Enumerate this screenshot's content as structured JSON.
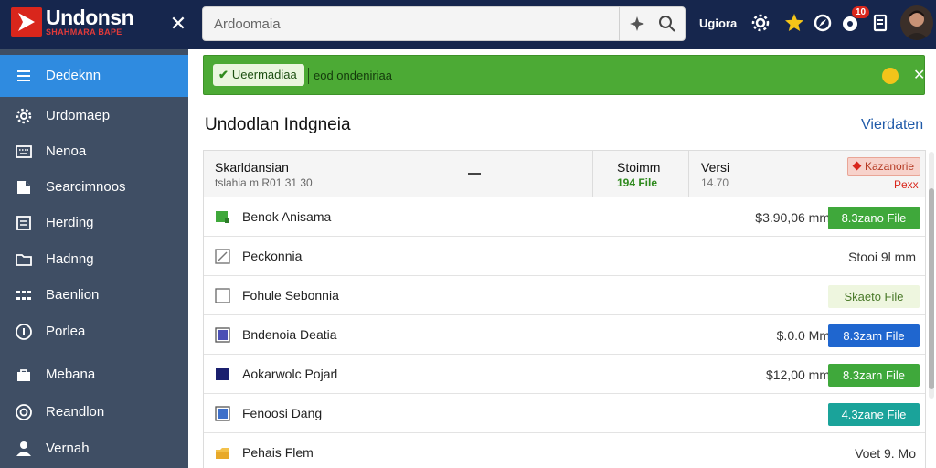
{
  "header": {
    "logo_text": "Undonsn",
    "logo_sub": "SHAHMARA BAPE",
    "search_placeholder": "Ardoomaia",
    "label": "Ugiora",
    "badge": "10",
    "icons": [
      "brand-logo-icon",
      "close-icon",
      "sparkle-icon",
      "search-icon",
      "settings-icon",
      "star-icon",
      "compass-icon",
      "shield-icon",
      "bookmark-icon",
      "avatar"
    ]
  },
  "sidebar": {
    "items": [
      {
        "label": "Dedeknn",
        "icon": "menu-icon",
        "active": true
      },
      {
        "label": "Urdomaep",
        "icon": "gear-icon"
      },
      {
        "label": "Nenoa",
        "icon": "keyboard-icon"
      },
      {
        "label": "Searcimnoos",
        "icon": "file-icon"
      },
      {
        "label": "Herding",
        "icon": "list-icon"
      },
      {
        "label": "Hadnng",
        "icon": "folder-icon"
      },
      {
        "label": "Baenlion",
        "icon": "grid-icon"
      },
      {
        "label": "Porlea",
        "icon": "info-icon"
      },
      {
        "label": "Mebana",
        "icon": "bag-icon"
      },
      {
        "label": "Reandlon",
        "icon": "circle-icon"
      },
      {
        "label": "Vernah",
        "icon": "person-icon"
      }
    ]
  },
  "banner": {
    "pill": "Ueermadiaa",
    "text": "eod ondeniriaa"
  },
  "section": {
    "title": "Undodlan Indgneia",
    "link": "Vierdaten"
  },
  "table": {
    "header": {
      "main": "Skarldansian",
      "sub": "tslahia m R01 31 30",
      "col2": "Stoimm",
      "col2_sub": "194 File",
      "col3": "Versi",
      "col3_sub": "14.70",
      "tag": "Kazanorie",
      "tag_sub": "Pexx"
    },
    "rows": [
      {
        "name": "Benok Anisama",
        "price": "$3.90,06 mm",
        "button": "8.3zano File",
        "style": "green",
        "icon": "green-square-icon"
      },
      {
        "name": "Peckonnia",
        "side": "Stooi 9l mm",
        "icon": "edit-icon"
      },
      {
        "name": "Fohule Sebonnia",
        "button": "Skaeto File",
        "style": "lightgreen",
        "icon": "checkbox-icon"
      },
      {
        "name": "Bndenoia Deatia",
        "price": "$.0.0 Mm",
        "button": "8.3zam File",
        "style": "blue",
        "icon": "purple-square-icon"
      },
      {
        "name": "Aokarwolc Pojarl",
        "price": "$12,00 mm",
        "button": "8.3zarn File",
        "style": "green",
        "icon": "navy-square-icon"
      },
      {
        "name": "Fenoosi Dang",
        "button": "4.3zane File",
        "style": "teal",
        "icon": "blue-square-icon"
      },
      {
        "name": "Pehais Flem",
        "side": "Voet 9. Mo",
        "icon": "folder-icon"
      }
    ]
  },
  "colors": {
    "header_bg": "#16264d",
    "sidebar_bg": "#3f4e64",
    "sidebar_active": "#2f8be0",
    "banner_green": "#4caa35",
    "brand_red": "#d9261c"
  }
}
